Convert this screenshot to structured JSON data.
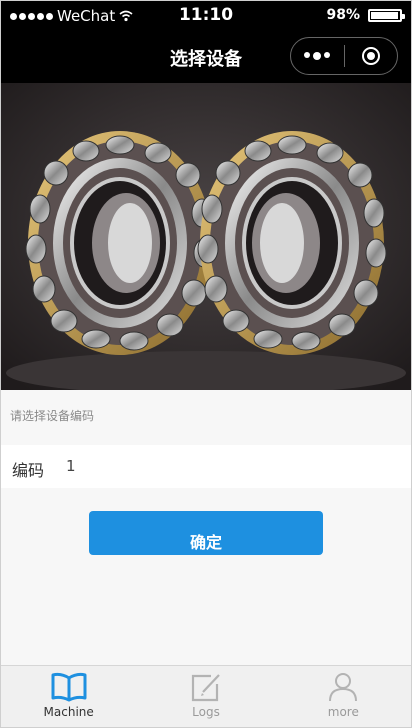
{
  "status_bar": {
    "carrier": "WeChat",
    "time": "11:10",
    "battery": "98%"
  },
  "nav": {
    "title": "选择设备"
  },
  "form": {
    "hint": "请选择设备编码",
    "code_label": "编码",
    "code_value": "1"
  },
  "confirm_label": "确定",
  "tabs": [
    {
      "label": "Machine",
      "icon": "book-icon",
      "active": true
    },
    {
      "label": "Logs",
      "icon": "edit-icon",
      "active": false
    },
    {
      "label": "more",
      "icon": "user-icon",
      "active": false
    }
  ],
  "colors": {
    "accent": "#1e90e0",
    "tab_active": "#1e90e0",
    "tab_inactive": "#a8a8a8"
  }
}
